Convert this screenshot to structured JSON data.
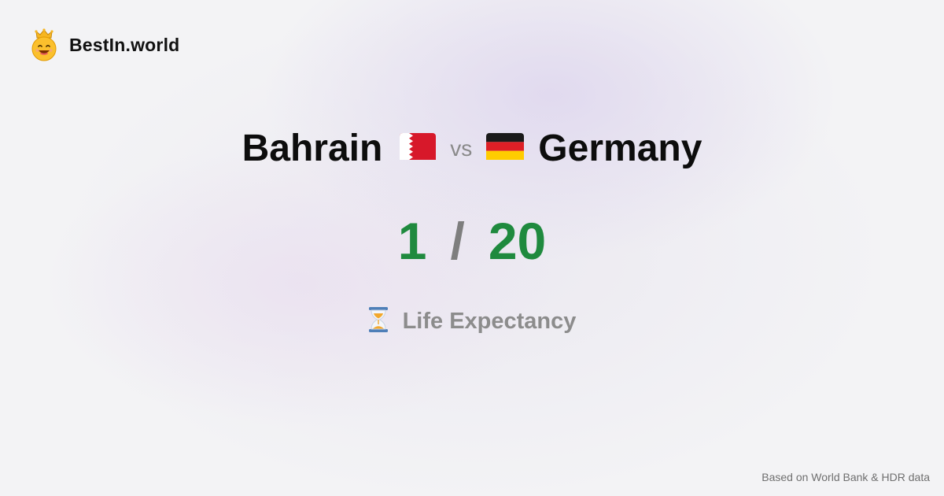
{
  "brand": {
    "name": "BestIn.world",
    "logo_icon": "crowned-smiley-icon"
  },
  "comparison": {
    "country_a": "Bahrain",
    "flag_a_icon": "bahrain-flag-icon",
    "vs_label": "vs",
    "country_b": "Germany",
    "flag_b_icon": "germany-flag-icon"
  },
  "ranks": {
    "rank_a": "1",
    "separator": "/",
    "rank_b": "20"
  },
  "metric": {
    "icon": "hourglass-icon",
    "label": "Life Expectancy"
  },
  "footer": {
    "source_note": "Based on World Bank & HDR data"
  },
  "colors": {
    "rank": "#1f8a3e",
    "muted": "#8c8c8c",
    "text": "#0d0d0d"
  }
}
